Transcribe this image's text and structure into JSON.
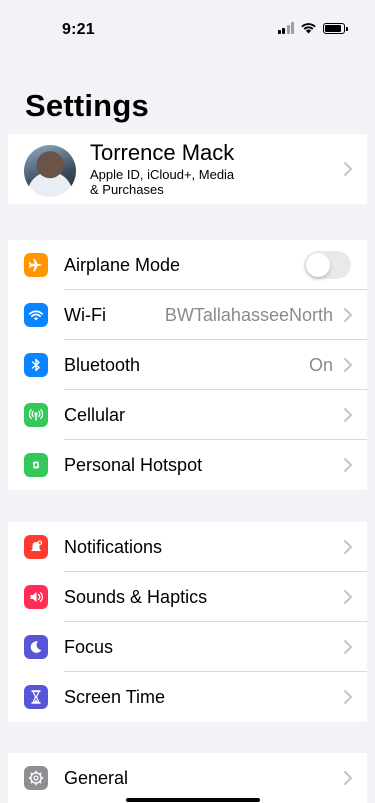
{
  "status": {
    "time": "9:21"
  },
  "title": "Settings",
  "profile": {
    "name": "Torrence Mack",
    "subtitle_line1": "Apple ID, iCloud+, Media",
    "subtitle_line2": "& Purchases"
  },
  "connectivity": [
    {
      "label": "Airplane Mode",
      "icon": "airplane-icon",
      "color": "#ff9500",
      "toggle": false
    },
    {
      "label": "Wi-Fi",
      "icon": "wifi-icon",
      "color": "#0a84ff",
      "value": "BWTallahasseeNorth"
    },
    {
      "label": "Bluetooth",
      "icon": "bluetooth-icon",
      "color": "#0a84ff",
      "value": "On"
    },
    {
      "label": "Cellular",
      "icon": "cellular-icon",
      "color": "#34c759"
    },
    {
      "label": "Personal Hotspot",
      "icon": "hotspot-icon",
      "color": "#34c759"
    }
  ],
  "alerts": [
    {
      "label": "Notifications",
      "icon": "notifications-icon",
      "color": "#ff3b30"
    },
    {
      "label": "Sounds & Haptics",
      "icon": "sounds-icon",
      "color": "#ff2d55"
    },
    {
      "label": "Focus",
      "icon": "moon-icon",
      "color": "#5856d6"
    },
    {
      "label": "Screen Time",
      "icon": "hourglass-icon",
      "color": "#5856d6"
    }
  ],
  "general": [
    {
      "label": "General",
      "icon": "gear-icon",
      "color": "#8e8e93"
    }
  ]
}
